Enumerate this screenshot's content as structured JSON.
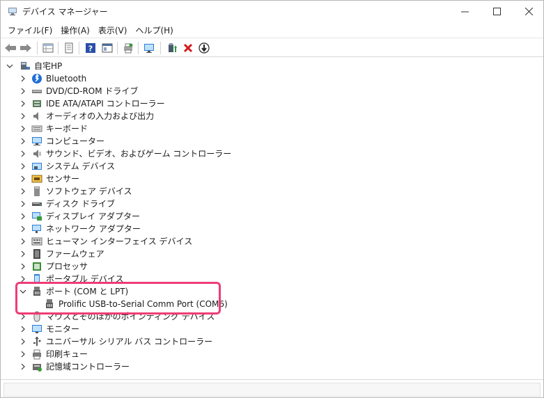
{
  "window": {
    "title": "デバイス マネージャー",
    "minimize": "—",
    "maximize": "☐",
    "close": "✕"
  },
  "menu": {
    "items": [
      "ファイル(F)",
      "操作(A)",
      "表示(V)",
      "ヘルプ(H)"
    ]
  },
  "tree": {
    "root": "自宅HP",
    "items": [
      {
        "label": "Bluetooth",
        "icon": "bluetooth-icon"
      },
      {
        "label": "DVD/CD-ROM ドライブ",
        "icon": "dvd-drive-icon"
      },
      {
        "label": "IDE ATA/ATAPI コントローラー",
        "icon": "ide-controller-icon"
      },
      {
        "label": "オーディオの入力および出力",
        "icon": "speaker-icon"
      },
      {
        "label": "キーボード",
        "icon": "keyboard-icon"
      },
      {
        "label": "コンピューター",
        "icon": "computer-icon"
      },
      {
        "label": "サウンド、ビデオ、およびゲーム コントローラー",
        "icon": "sound-icon"
      },
      {
        "label": "システム デバイス",
        "icon": "system-device-icon"
      },
      {
        "label": "センサー",
        "icon": "sensor-icon"
      },
      {
        "label": "ソフトウェア デバイス",
        "icon": "software-device-icon"
      },
      {
        "label": "ディスク ドライブ",
        "icon": "disk-drive-icon"
      },
      {
        "label": "ディスプレイ アダプター",
        "icon": "display-adapter-icon"
      },
      {
        "label": "ネットワーク アダプター",
        "icon": "network-adapter-icon"
      },
      {
        "label": "ヒューマン インターフェイス デバイス",
        "icon": "hid-icon"
      },
      {
        "label": "ファームウェア",
        "icon": "firmware-icon"
      },
      {
        "label": "プロセッサ",
        "icon": "processor-icon"
      },
      {
        "label": "ポータブル デバイス",
        "icon": "portable-device-icon"
      },
      {
        "label": "ポート (COM と LPT)",
        "icon": "port-icon",
        "expanded": true
      },
      {
        "label": "Prolific USB-to-Serial Comm Port (COM6)",
        "icon": "port-icon",
        "child": true
      },
      {
        "label": "マウスとそのほかのポインティング デバイス",
        "icon": "mouse-icon"
      },
      {
        "label": "モニター",
        "icon": "monitor-icon"
      },
      {
        "label": "ユニバーサル シリアル バス コントローラー",
        "icon": "usb-icon"
      },
      {
        "label": "印刷キュー",
        "icon": "printer-icon"
      },
      {
        "label": "記憶域コントローラー",
        "icon": "storage-controller-icon"
      }
    ]
  },
  "colors": {
    "highlight": "#ef3c76",
    "accent_blue": "#2b7cd3",
    "delete_red": "#d6191b",
    "update_green": "#2a9a3c"
  }
}
